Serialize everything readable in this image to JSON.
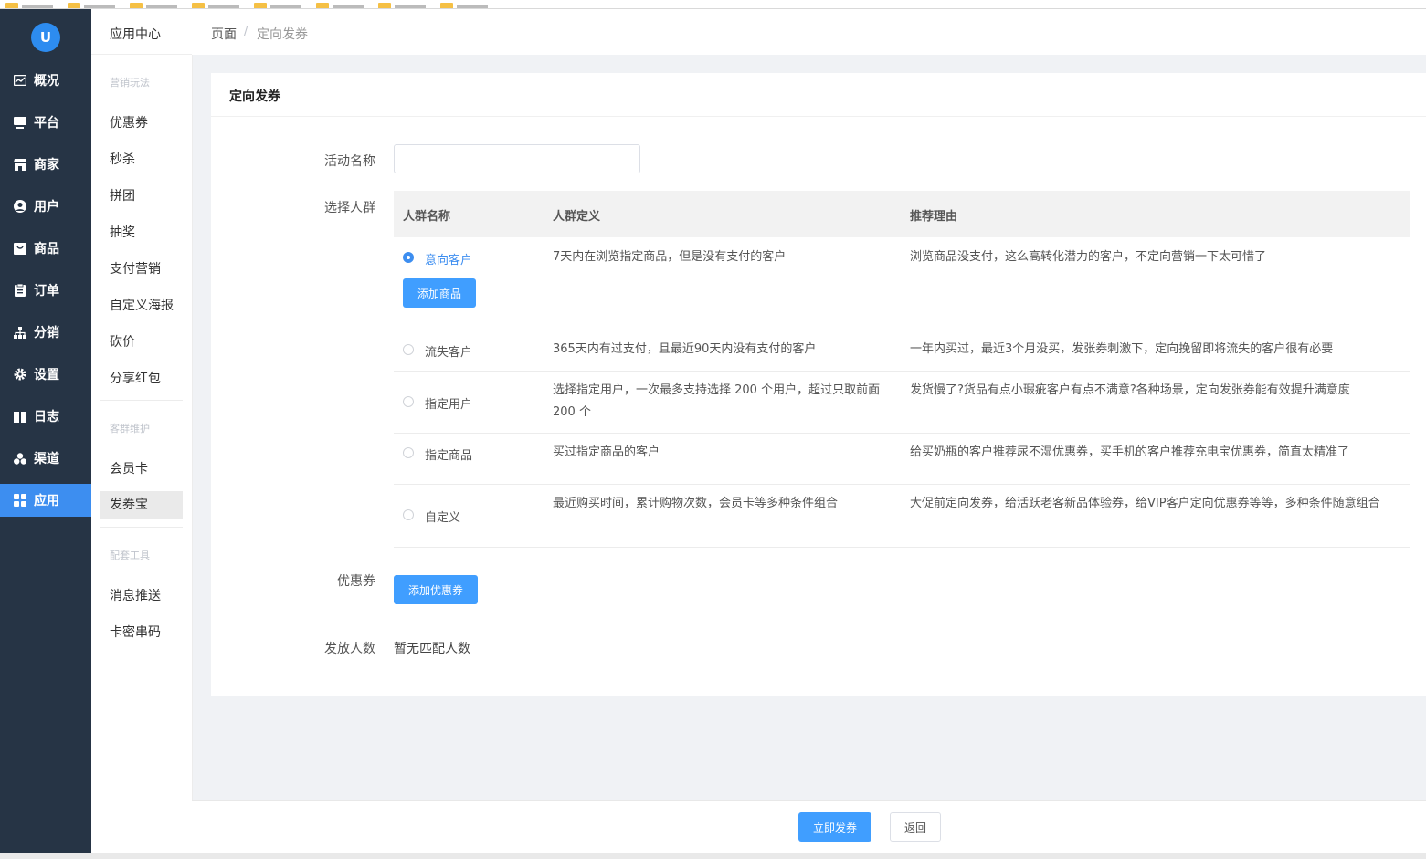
{
  "nav": {
    "logo_text": "U",
    "items": [
      {
        "label": "概况",
        "icon": "chart-icon",
        "active": false
      },
      {
        "label": "平台",
        "icon": "monitor-icon",
        "active": false
      },
      {
        "label": "商家",
        "icon": "store-icon",
        "active": false
      },
      {
        "label": "用户",
        "icon": "user-icon",
        "active": false
      },
      {
        "label": "商品",
        "icon": "bag-icon",
        "active": false
      },
      {
        "label": "订单",
        "icon": "clipboard-icon",
        "active": false
      },
      {
        "label": "分销",
        "icon": "hierarchy-icon",
        "active": false
      },
      {
        "label": "设置",
        "icon": "gear-icon",
        "active": false
      },
      {
        "label": "日志",
        "icon": "book-icon",
        "active": false
      },
      {
        "label": "渠道",
        "icon": "cluster-icon",
        "active": false
      },
      {
        "label": "应用",
        "icon": "grid-icon",
        "active": true
      }
    ]
  },
  "subnav": {
    "title": "应用中心",
    "groups": [
      {
        "title": "营销玩法",
        "items": [
          "优惠券",
          "秒杀",
          "拼团",
          "抽奖",
          "支付营销",
          "自定义海报",
          "砍价",
          "分享红包"
        ]
      },
      {
        "title": "客群维护",
        "items": [
          "会员卡",
          "发券宝"
        ]
      },
      {
        "title": "配套工具",
        "items": [
          "消息推送",
          "卡密串码"
        ]
      }
    ],
    "active_item": "发券宝"
  },
  "breadcrumb": {
    "root": "页面",
    "separator": "/",
    "current": "定向发券"
  },
  "card": {
    "title": "定向发券"
  },
  "form": {
    "name_label": "活动名称",
    "name_value": "",
    "crowd_label": "选择人群",
    "coupon_label": "优惠券",
    "add_coupon_button": "添加优惠券",
    "count_label": "发放人数",
    "count_value": "暂无匹配人数"
  },
  "table": {
    "headers": [
      "人群名称",
      "人群定义",
      "推荐理由"
    ],
    "rows": [
      {
        "name": "意向客户",
        "selected": true,
        "definition": "7天内在浏览指定商品，但是没有支付的客户",
        "reason": "浏览商品没支付，这么高转化潜力的客户，不定向营销一下太可惜了",
        "button": "添加商品"
      },
      {
        "name": "流失客户",
        "selected": false,
        "definition": "365天内有过支付，且最近90天内没有支付的客户",
        "reason": "一年内买过，最近3个月没买，发张券刺激下，定向挽留即将流失的客户很有必要"
      },
      {
        "name": "指定用户",
        "selected": false,
        "definition": "选择指定用户，一次最多支持选择 200 个用户，超过只取前面 200 个",
        "reason": "发货慢了?货品有点小瑕疵客户有点不满意?各种场景，定向发张券能有效提升满意度"
      },
      {
        "name": "指定商品",
        "selected": false,
        "definition": "买过指定商品的客户",
        "reason": "给买奶瓶的客户推荐尿不湿优惠券，买手机的客户推荐充电宝优惠券，简直太精准了"
      },
      {
        "name": "自定义",
        "selected": false,
        "definition": "最近购买时间，累计购物次数，会员卡等多种条件组合",
        "reason": "大促前定向发券，给活跃老客新品体验券，给VIP客户定向优惠券等等，多种条件随意组合"
      }
    ]
  },
  "footer": {
    "submit_button": "立即发券",
    "back_button": "返回"
  },
  "colors": {
    "accent": "#409eff",
    "sidebar": "#263445",
    "active_nav": "#3d8ef0"
  }
}
